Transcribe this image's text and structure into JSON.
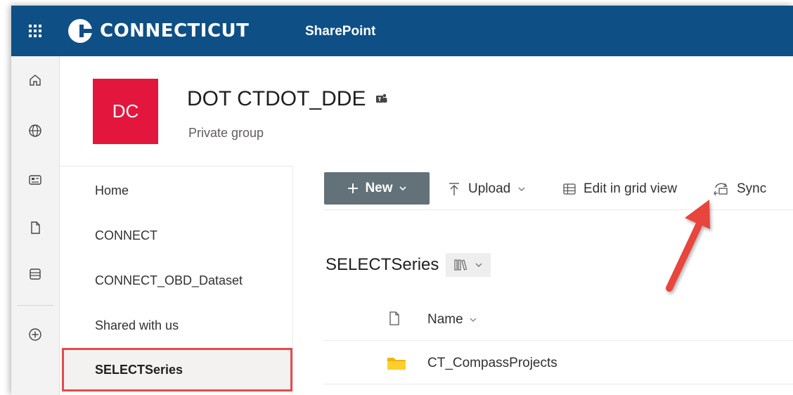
{
  "topbar": {
    "brand_name": "CONNECTICUT",
    "app_name": "SharePoint",
    "color": "#0e4f86"
  },
  "rail": {
    "icons": [
      "home-icon",
      "globe-icon",
      "news-icon",
      "file-icon",
      "list-icon",
      "add-circle-icon"
    ]
  },
  "site": {
    "logo_initials": "DC",
    "logo_color": "#e3173e",
    "title": "DOT CTDOT_DDE",
    "subtitle": "Private group"
  },
  "nav": {
    "items": [
      {
        "label": "Home"
      },
      {
        "label": "CONNECT"
      },
      {
        "label": "CONNECT_OBD_Dataset"
      },
      {
        "label": "Shared with us"
      },
      {
        "label": "SELECTSeries",
        "selected": true
      }
    ]
  },
  "commands": {
    "new_label": "New",
    "upload_label": "Upload",
    "grid_label": "Edit in grid view",
    "sync_label": "Sync"
  },
  "library": {
    "title": "SELECTSeries",
    "column_name": "Name",
    "rows": [
      {
        "name": "CT_CompassProjects",
        "type": "folder"
      }
    ]
  },
  "annotation": {
    "arrow_color": "#e8453c",
    "highlight_color": "#e44c4c"
  }
}
